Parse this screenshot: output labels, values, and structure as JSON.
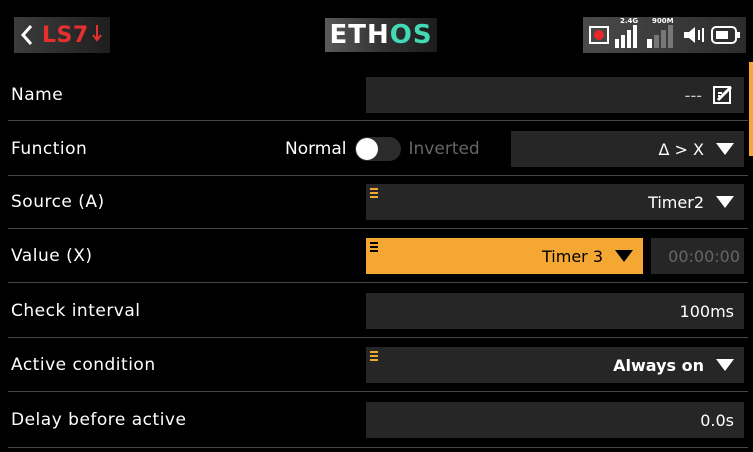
{
  "header": {
    "title": "LS7",
    "logo": {
      "part1": "ETH",
      "part2": "OS",
      "accent": "#43d9b4"
    },
    "status": {
      "band1": "2.4G",
      "band2": "900M"
    }
  },
  "rows": [
    {
      "label": "Name",
      "value": "---",
      "icon": "edit-icon"
    },
    {
      "label": "Function",
      "mode_on": "Normal",
      "mode_off": "Inverted",
      "value": "Δ > X"
    },
    {
      "label": "Source (A)",
      "value": "Timer2"
    },
    {
      "label": "Value (X)",
      "value": "Timer 3",
      "time": "00:00:00"
    },
    {
      "label": "Check interval",
      "value": "100ms"
    },
    {
      "label": "Active condition",
      "value": "Always on"
    },
    {
      "label": "Delay before active",
      "value": "0.0s"
    }
  ],
  "colors": {
    "accent": "#f4a732",
    "title_red": "#e63030",
    "field_bg": "#262626"
  }
}
